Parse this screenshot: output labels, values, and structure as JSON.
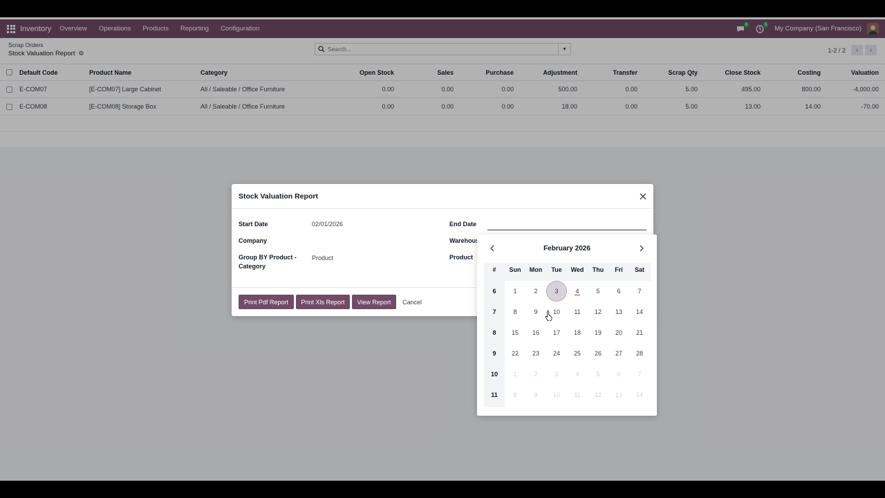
{
  "navbar": {
    "app_name": "Inventory",
    "menu": [
      "Overview",
      "Operations",
      "Products",
      "Reporting",
      "Configuration"
    ],
    "messages_badge": "8",
    "activities_badge": "5",
    "company": "My Company (San Francisco)"
  },
  "control": {
    "breadcrumb": "Scrap Orders",
    "title": "Stock Valuation Report",
    "search_placeholder": "Search...",
    "pager": "1-2 / 2"
  },
  "list": {
    "headers": [
      "Default Code",
      "Product Name",
      "Category",
      "Open Stock",
      "Sales",
      "Purchase",
      "Adjustment",
      "Transfer",
      "Scrap Qty",
      "Close Stock",
      "Costing",
      "Valuation"
    ],
    "rows": [
      [
        "E-COM07",
        "[E-COM07] Large Cabinet",
        "All / Saleable / Office Furniture",
        "0.00",
        "0.00",
        "0.00",
        "500.00",
        "0.00",
        "5.00",
        "495.00",
        "800.00",
        "-4,000.00"
      ],
      [
        "E-COM08",
        "[E-COM08] Storage Box",
        "All / Saleable / Office Furniture",
        "0.00",
        "0.00",
        "0.00",
        "18.00",
        "0.00",
        "5.00",
        "13.00",
        "14.00",
        "-70.00"
      ]
    ]
  },
  "modal": {
    "title": "Stock Valuation Report",
    "start_date_label": "Start Date",
    "start_date_value": "02/01/2026",
    "end_date_label": "End Date",
    "end_date_value": "",
    "company_label": "Company",
    "warehouse_label": "Warehouse",
    "group_by_label_1": "Group BY Product -",
    "group_by_label_2": "Category",
    "group_by_value": "Product",
    "product_label": "Product",
    "buttons": {
      "print_pdf": "Print Pdf Report",
      "print_xls": "Print Xls Report",
      "view": "View Report",
      "cancel": "Cancel"
    }
  },
  "datepicker": {
    "month_label": "February 2026",
    "dow": [
      "#",
      "Sun",
      "Mon",
      "Tue",
      "Wed",
      "Thu",
      "Fri",
      "Sat"
    ],
    "weeks": [
      {
        "wk": "6",
        "days": [
          "1",
          "2",
          "3",
          "4",
          "5",
          "6",
          "7"
        ],
        "muted": [
          false,
          false,
          false,
          false,
          false,
          false,
          false
        ]
      },
      {
        "wk": "7",
        "days": [
          "8",
          "9",
          "10",
          "11",
          "12",
          "13",
          "14"
        ],
        "muted": [
          false,
          false,
          false,
          false,
          false,
          false,
          false
        ]
      },
      {
        "wk": "8",
        "days": [
          "15",
          "16",
          "17",
          "18",
          "19",
          "20",
          "21"
        ],
        "muted": [
          false,
          false,
          false,
          false,
          false,
          false,
          false
        ]
      },
      {
        "wk": "9",
        "days": [
          "22",
          "23",
          "24",
          "25",
          "26",
          "27",
          "28"
        ],
        "muted": [
          false,
          false,
          false,
          false,
          false,
          false,
          false
        ]
      },
      {
        "wk": "10",
        "days": [
          "1",
          "2",
          "3",
          "4",
          "5",
          "6",
          "7"
        ],
        "muted": [
          true,
          true,
          true,
          true,
          true,
          true,
          true
        ]
      },
      {
        "wk": "11",
        "days": [
          "8",
          "9",
          "10",
          "11",
          "12",
          "13",
          "14"
        ],
        "muted": [
          true,
          true,
          true,
          true,
          true,
          true,
          true
        ]
      }
    ],
    "selected_day": "3",
    "today_day": "4"
  },
  "colors": {
    "brand": "#714B67",
    "today_underline": "#e11d48"
  }
}
